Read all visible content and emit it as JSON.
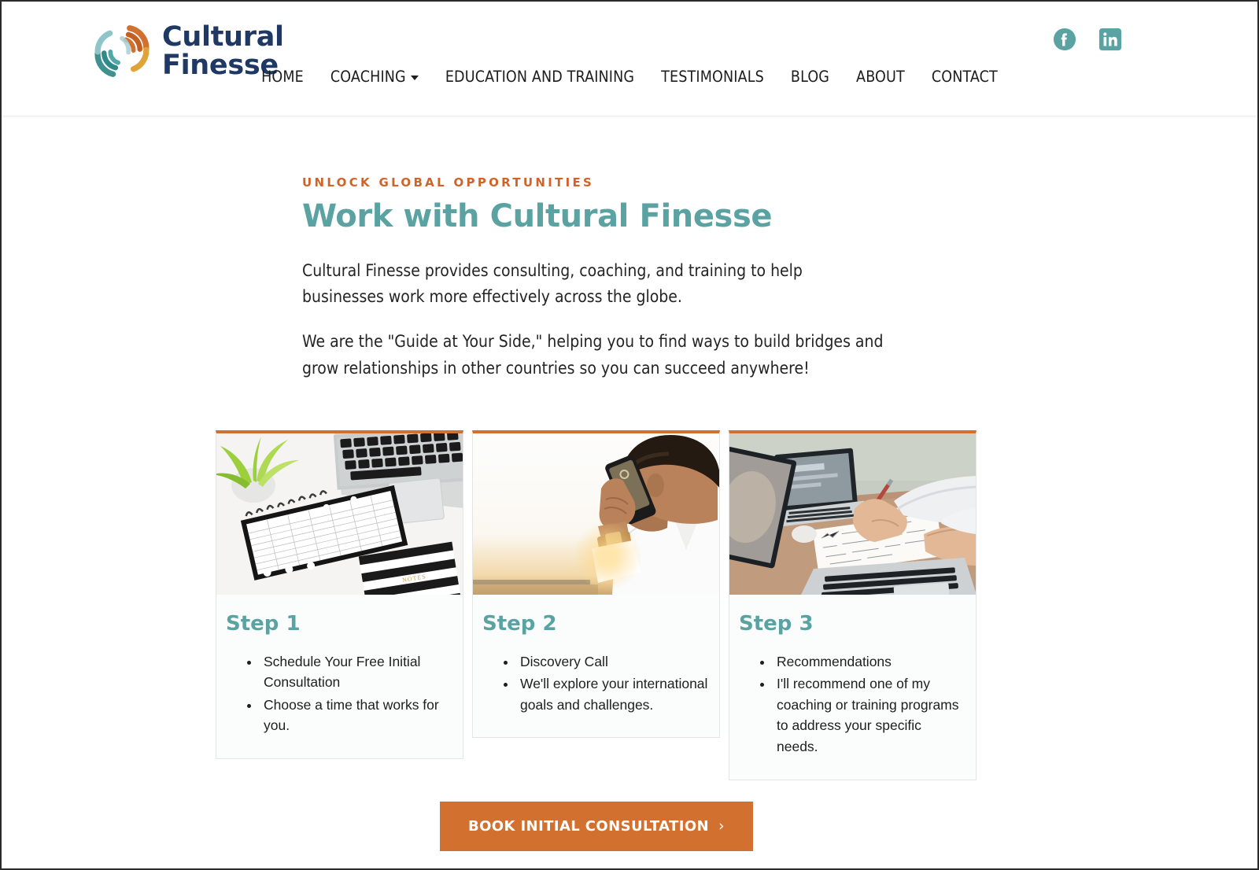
{
  "brand": {
    "name": "Cultural Finesse",
    "wordmark_line1": "Cultural",
    "wordmark_line2": "Finesse",
    "wordmark": "Cultural\nFinesse",
    "logo_colors": {
      "teal": "#4d9b9b",
      "orange": "#d2702f",
      "gold": "#e0a33a",
      "navy": "#1f3864"
    }
  },
  "header": {
    "social": [
      {
        "name": "facebook",
        "label": "Facebook"
      },
      {
        "name": "linkedin",
        "label": "LinkedIn"
      }
    ],
    "social_color": "#5ba3a3",
    "nav": [
      {
        "label": "HOME",
        "has_dropdown": false
      },
      {
        "label": "COACHING",
        "has_dropdown": true
      },
      {
        "label": "EDUCATION AND TRAINING",
        "has_dropdown": false
      },
      {
        "label": "TESTIMONIALS",
        "has_dropdown": false
      },
      {
        "label": "BLOG",
        "has_dropdown": false
      },
      {
        "label": "ABOUT",
        "has_dropdown": false
      },
      {
        "label": "CONTACT",
        "has_dropdown": false
      }
    ]
  },
  "intro": {
    "eyebrow": "UNLOCK GLOBAL OPPORTUNITIES",
    "eyebrow_color": "#cf642a",
    "headline": "Work with Cultural Finesse",
    "headline_color": "#5ba3a3",
    "paragraph1": "Cultural Finesse provides consulting, coaching, and training to help businesses work more effectively across the globe.",
    "paragraph2": "We are the \"Guide at Your Side,\" helping you to find ways to build bridges and grow relationships in other countries so you can succeed anywhere!"
  },
  "steps": [
    {
      "title": "Step 1",
      "image_name": "desk-planner-laptop-photo",
      "image_alt": "Spiral planner notebook on a white desk beside a laptop keyboard and a green plant",
      "bullets": [
        "Schedule Your Free Initial Consultation",
        "Choose a time that works for you."
      ]
    },
    {
      "title": "Step 2",
      "image_name": "man-on-phone-call-photo",
      "image_alt": "Man in a white shirt talking on a mobile phone at sunset",
      "bullets": [
        "Discovery Call",
        "We'll explore your international goals and challenges."
      ]
    },
    {
      "title": "Step 3",
      "image_name": "team-working-laptops-photo",
      "image_alt": "Two people reviewing handwritten notes beside laptops on a wooden table",
      "bullets": [
        "Recommendations",
        "I'll recommend one of my coaching or training programs to address your specific needs."
      ]
    }
  ],
  "cta": {
    "label": "BOOK INITIAL CONSULTATION",
    "chevron": "›",
    "background": "#d2702f",
    "text_color": "#ffffff"
  },
  "theme": {
    "teal": "#5ba3a3",
    "orange": "#d2702f",
    "navy": "#1f3864",
    "card_bg": "#fbfcfc",
    "card_border": "#e4e6e6",
    "page_bg": "#ffffff"
  }
}
